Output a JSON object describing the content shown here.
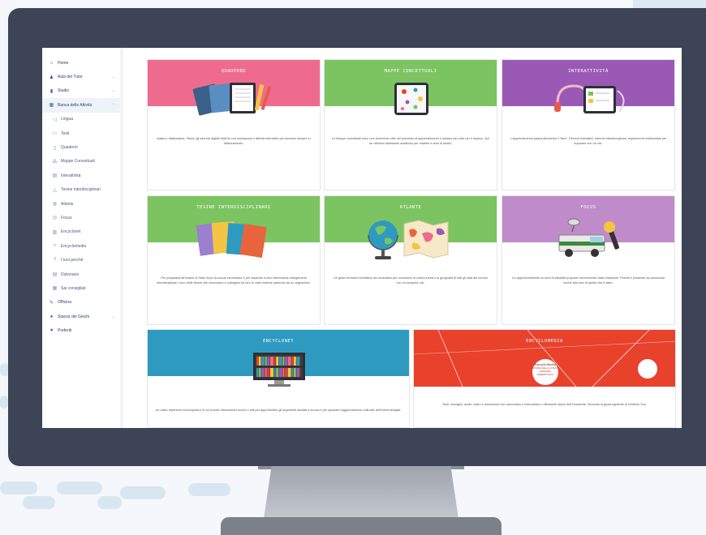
{
  "colors": {
    "pink": "#ef6b8e",
    "green": "#7cc461",
    "purple": "#9b59b6",
    "teal": "#2f9ac0",
    "red": "#e8412c",
    "lilac": "#c08bc9",
    "frame": "#3d4456"
  },
  "sidebar": {
    "items": [
      {
        "label": "Home",
        "icon": "home-icon",
        "glyph": "⌂"
      },
      {
        "label": "Aula del Tutor",
        "icon": "person-icon",
        "glyph": "♟"
      },
      {
        "label": "Studio",
        "icon": "book-icon",
        "glyph": "▮"
      },
      {
        "label": "Banca delle Attività",
        "icon": "folder-icon",
        "glyph": "▦"
      },
      {
        "label": "Lingua",
        "icon": "bubble-icon",
        "glyph": "◁"
      },
      {
        "label": "Testi",
        "icon": "screen-icon",
        "glyph": "▭"
      },
      {
        "label": "Quaderni",
        "icon": "page-icon",
        "glyph": "▯"
      },
      {
        "label": "Mappe Concettuali",
        "icon": "network-icon",
        "glyph": "⁂"
      },
      {
        "label": "Interattività",
        "icon": "grid-icon",
        "glyph": "▤"
      },
      {
        "label": "Tesine interdisciplinari",
        "icon": "triangle-icon",
        "glyph": "△"
      },
      {
        "label": "Atlante",
        "icon": "globe-icon",
        "glyph": "◍"
      },
      {
        "label": "Focus",
        "icon": "eye-icon",
        "glyph": "◎"
      },
      {
        "label": "Encyclonet",
        "icon": "books-icon",
        "glyph": "▥"
      },
      {
        "label": "Encyclomedia",
        "icon": "search-icon",
        "glyph": "⌕"
      },
      {
        "label": "I tuoi perché",
        "icon": "question-icon",
        "glyph": "?"
      },
      {
        "label": "Dizionario",
        "icon": "dictionary-icon",
        "glyph": "▤"
      },
      {
        "label": "Sai consigliati",
        "icon": "calendar-icon",
        "glyph": "▦"
      },
      {
        "label": "Officina",
        "icon": "wrench-icon",
        "glyph": "✎"
      },
      {
        "label": "Stanza dei Giochi",
        "icon": "game-icon",
        "glyph": "●"
      },
      {
        "label": "Preferiti",
        "icon": "heart-icon",
        "glyph": "♥"
      }
    ]
  },
  "cards": [
    {
      "title": "QUADERNI",
      "text": "Italiano, Matematica, Storia: gli esercizi digitali MyEdu con simulazioni e attività interattive per lavorare sempre in affiancamento."
    },
    {
      "title": "MAPPE CONCETTUALI",
      "text": "Le Mappe concettuali sono uno strumento utile nel processo di apprendimento e aiutano più volte per il ripasso. Qui ne offriamo tantissime suddivise per materie e anni di studio."
    },
    {
      "title": "INTERATTIVITÀ",
      "text": "L'apprendimento passa attraverso il \"fare\". Esercizi interattivi, Internet interdisciplinari, esperimenti multimediali per imparare con un clic."
    },
    {
      "title": "TESINE INTERDISCIPLINARI",
      "text": "Per prepararsi all'esame di Stato dopo la scuola secondaria e per imparare a fare interessanti collegamenti interdisciplinari: ecco delle tesine che mescolano e collegano tra loro le varie materie partendo da un argomento."
    },
    {
      "title": "ATLANTE",
      "text": "Un globo terrestre interattivo da consultare per conoscere la nostra storia e la geografia di tutti gli stati del mondo con un semplice clic."
    },
    {
      "title": "FOCUS",
      "text": "Un approfondimento su temi di attualità proposto mensilmente dalla redazione. Perché il presente va conosciuto anche alla luce di quello che è stato."
    },
    {
      "title": "ENCYCLONET",
      "text": "Un vasto repertorio enciclopedico in cui trovare informazioni sicure e utili per approfondire gli argomenti studiati a scuola e per spaziare l'aggiornamento culturale dell'intera famiglia."
    },
    {
      "title": "ENCYCLOMEDIA",
      "text": "Testi, immagini, audio, video e animazioni che raccontano e interpretano i riferimenti storici dell'Occidente. Secondo la guida sapiente di Umberto Eco."
    }
  ],
  "encyclomedia_badge": {
    "line1": "EncycloMedia",
    "line2": "STORIA DELLA CIVILTÀ EUROPEA",
    "line3": "UMBERTO ECO"
  }
}
